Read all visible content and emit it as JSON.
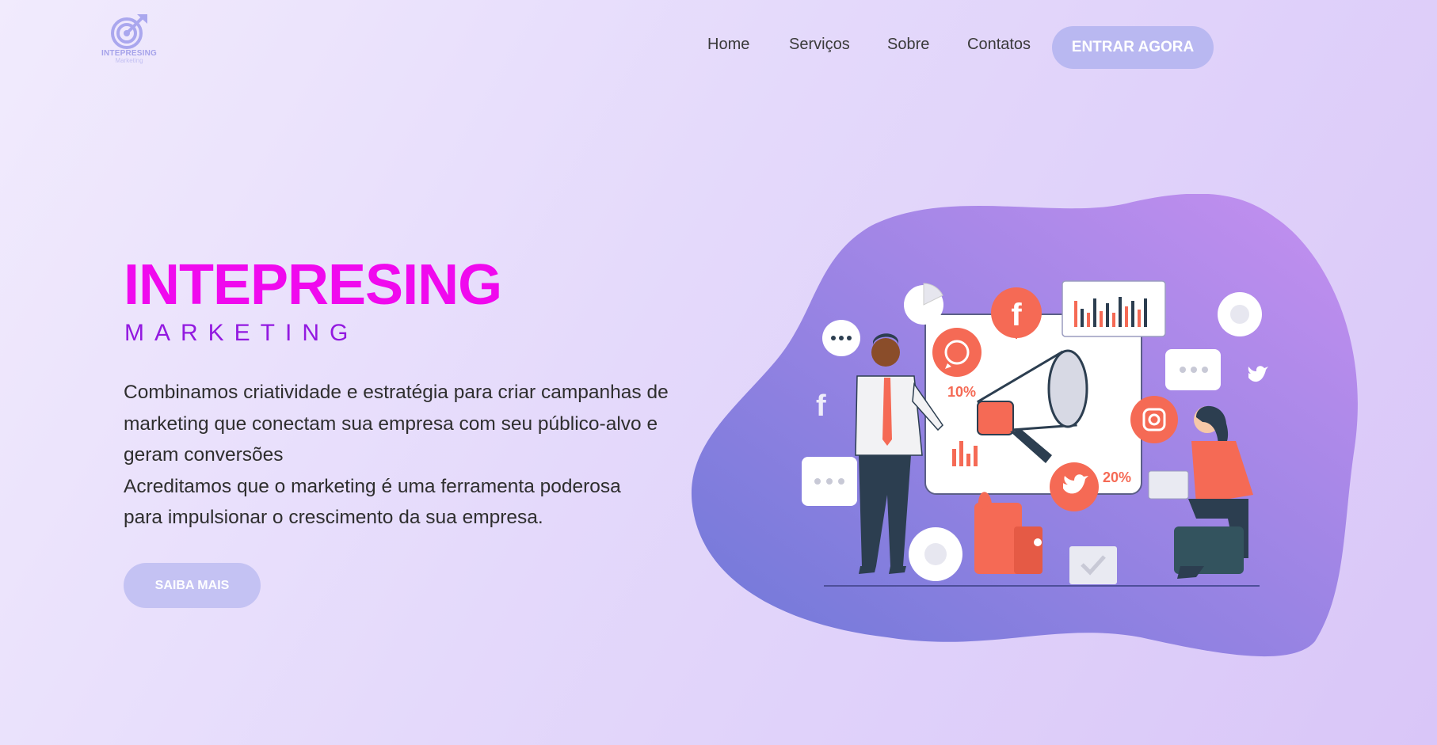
{
  "logo": {
    "name": "INTEPRESING",
    "sub": "Marketing"
  },
  "nav": {
    "links": [
      "Home",
      "Serviços",
      "Sobre",
      "Contatos"
    ],
    "cta_label": "ENTRAR AGORA"
  },
  "hero": {
    "title": "INTEPRESING",
    "subtitle": "MARKETING",
    "paragraph_1": "Combinamos criatividade e estratégia para criar campanhas de marketing que conectam sua empresa com seu público-alvo e geram conversões",
    "paragraph_2": "Acreditamos que o marketing é uma ferramenta poderosa para impulsionar o crescimento da sua empresa.",
    "button_label": "SAIBA MAIS"
  },
  "illustration": {
    "stat_left": "10%",
    "stat_right": "20%",
    "icons": [
      "whatsapp-icon",
      "facebook-icon",
      "instagram-icon",
      "twitter-icon",
      "megaphone-icon",
      "thumbs-up-icon",
      "pie-chart-icon",
      "bar-chart-icon",
      "chat-bubble-icon"
    ]
  },
  "colors": {
    "accent_title": "#f009ee",
    "accent_subtitle": "#9319e0",
    "button": "#b9b8f1",
    "blob_start": "#6f78d8",
    "blob_end": "#c590f0",
    "coral": "#f56a55"
  }
}
